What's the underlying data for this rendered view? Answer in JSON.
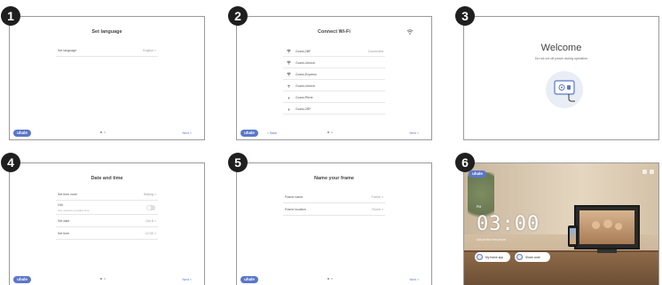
{
  "steps": [
    {
      "number": "1",
      "title": "Set language",
      "rows": [
        {
          "label": "Set language",
          "value": "English >"
        }
      ],
      "next": "Next >"
    },
    {
      "number": "2",
      "title": "Connect Wi-Fi",
      "networks": [
        {
          "name": "Guest-2BF",
          "status": "Connected"
        },
        {
          "name": "Guest-4rmrcb",
          "status": ""
        },
        {
          "name": "Guest-Express",
          "status": ""
        },
        {
          "name": "Guest-4rmrcb",
          "status": ""
        },
        {
          "name": "Guest-Pfrrte",
          "status": ""
        },
        {
          "name": "Guest-2RF",
          "status": ""
        }
      ],
      "back": "< Back",
      "next": "Next >"
    },
    {
      "number": "3",
      "title": "Welcome",
      "subtitle": "Do not cut off power during operation"
    },
    {
      "number": "4",
      "title": "Date and time",
      "rows": [
        {
          "label": "Set time zone",
          "value": "Beijing >"
        },
        {
          "label": "24h",
          "sub": "Use network provided time",
          "value": ""
        },
        {
          "label": "Set date",
          "value": "Oct 8 >"
        },
        {
          "label": "Set time",
          "value": "12:30 >"
        }
      ],
      "next": "Next >"
    },
    {
      "number": "5",
      "title": "Name your frame",
      "rows": [
        {
          "label": "Frame name",
          "value": "Frame >"
        },
        {
          "label": "Frame location",
          "value": "Room >"
        }
      ],
      "next": "Next >"
    },
    {
      "number": "6",
      "clock": "03:00",
      "ampm": "PM",
      "caption": "Add photos from phone",
      "buttons": [
        "My frame app",
        "Share code"
      ]
    }
  ],
  "brand": "uhale",
  "colors": {
    "accent": "#5a77c9",
    "badge": "#1f1f1f"
  }
}
